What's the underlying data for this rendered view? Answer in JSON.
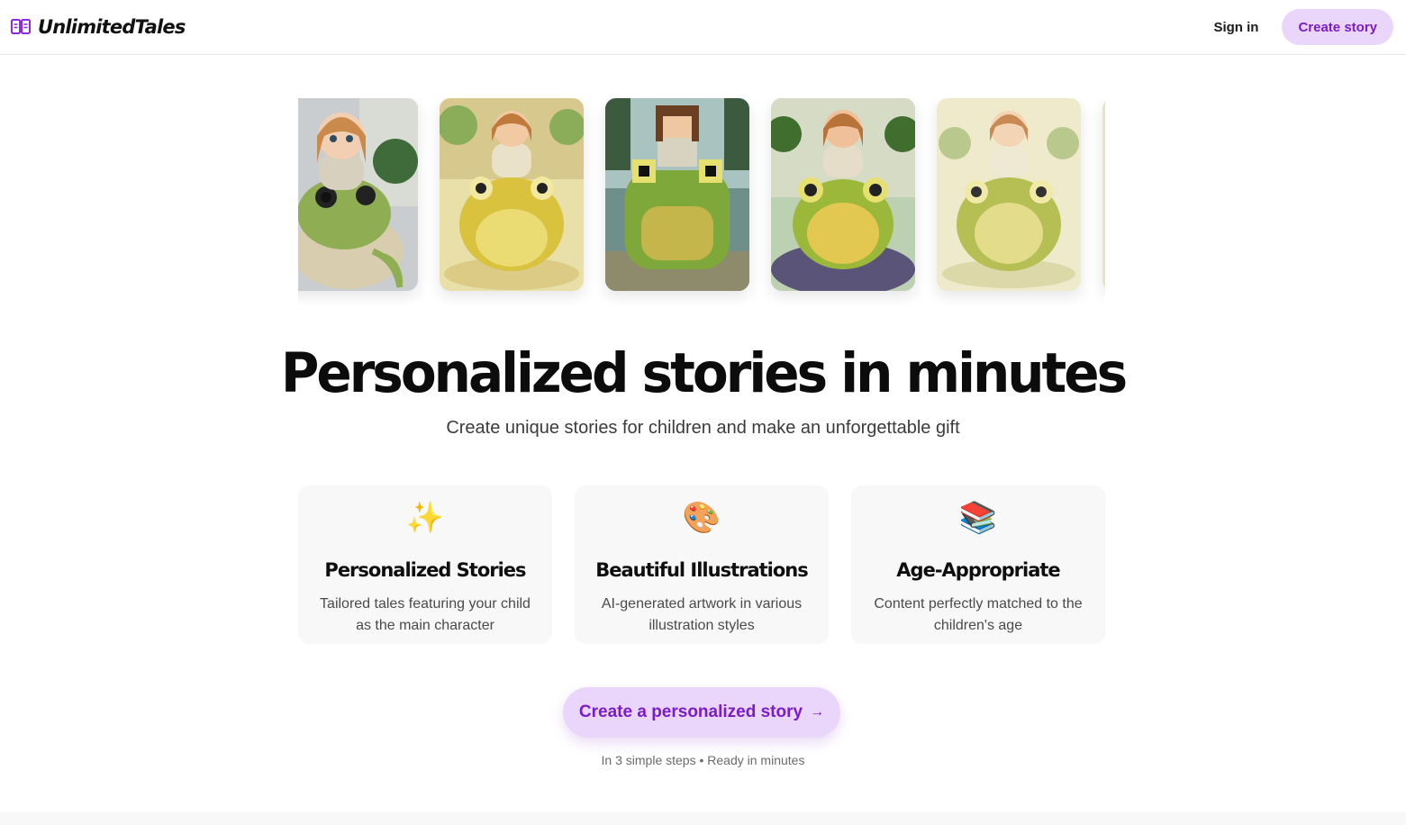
{
  "header": {
    "brand_name": "UnlimitedTales",
    "sign_in_label": "Sign in",
    "create_story_label": "Create story"
  },
  "carousel": {
    "slides": [
      {
        "icon": "girl-on-frog-3d-illustration"
      },
      {
        "icon": "girl-on-frog-watercolor-illustration"
      },
      {
        "icon": "girl-on-frog-pixel-illustration"
      },
      {
        "icon": "girl-on-frog-clay-illustration"
      },
      {
        "icon": "girl-on-frog-pencil-illustration"
      }
    ]
  },
  "hero": {
    "title": "Personalized stories in minutes",
    "subtitle": "Create unique stories for children and make an unforgettable gift"
  },
  "features": [
    {
      "emoji": "✨",
      "icon": "sparkles-icon",
      "title": "Personalized Stories",
      "text": "Tailored tales featuring your child as the main character"
    },
    {
      "emoji": "🎨",
      "icon": "palette-icon",
      "title": "Beautiful Illustrations",
      "text": "AI-generated artwork in various illustration styles"
    },
    {
      "emoji": "📚",
      "icon": "books-icon",
      "title": "Age-Appropriate",
      "text": "Content perfectly matched to the children's age"
    }
  ],
  "cta": {
    "label": "Create a personalized story",
    "arrow": "→",
    "note": "In 3 simple steps • Ready in minutes"
  },
  "colors": {
    "accent_bg": "#ead5fb",
    "accent_text": "#7a1cc7",
    "card_bg": "#f7f8f7"
  }
}
